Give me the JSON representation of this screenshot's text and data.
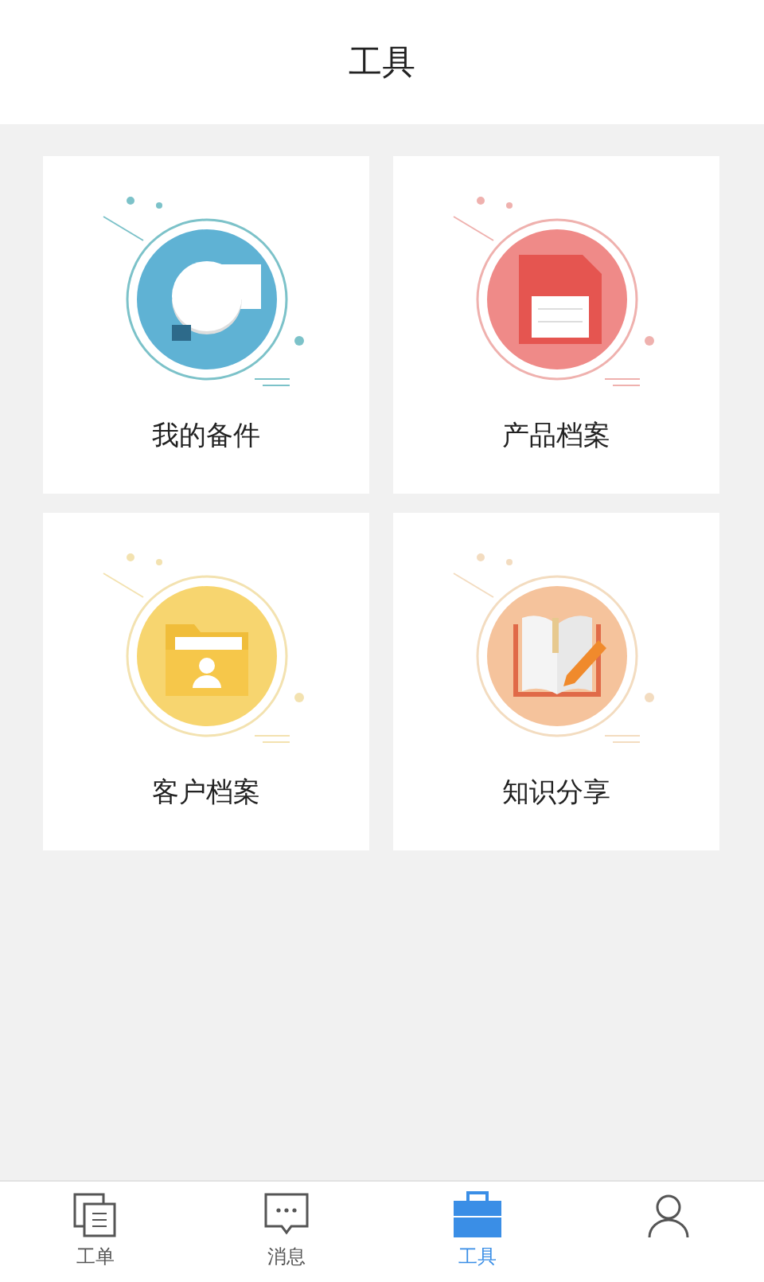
{
  "header": {
    "title": "工具"
  },
  "tools": [
    {
      "label": "我的备件",
      "kind": "camera"
    },
    {
      "label": "产品档案",
      "kind": "floppy"
    },
    {
      "label": "客户档案",
      "kind": "folder"
    },
    {
      "label": "知识分享",
      "kind": "book"
    }
  ],
  "tabs": [
    {
      "label": "工单",
      "kind": "orders",
      "selected": false
    },
    {
      "label": "消息",
      "kind": "message",
      "selected": false
    },
    {
      "label": "工具",
      "kind": "toolbox",
      "selected": true
    },
    {
      "kind": "person",
      "selected": false
    }
  ]
}
